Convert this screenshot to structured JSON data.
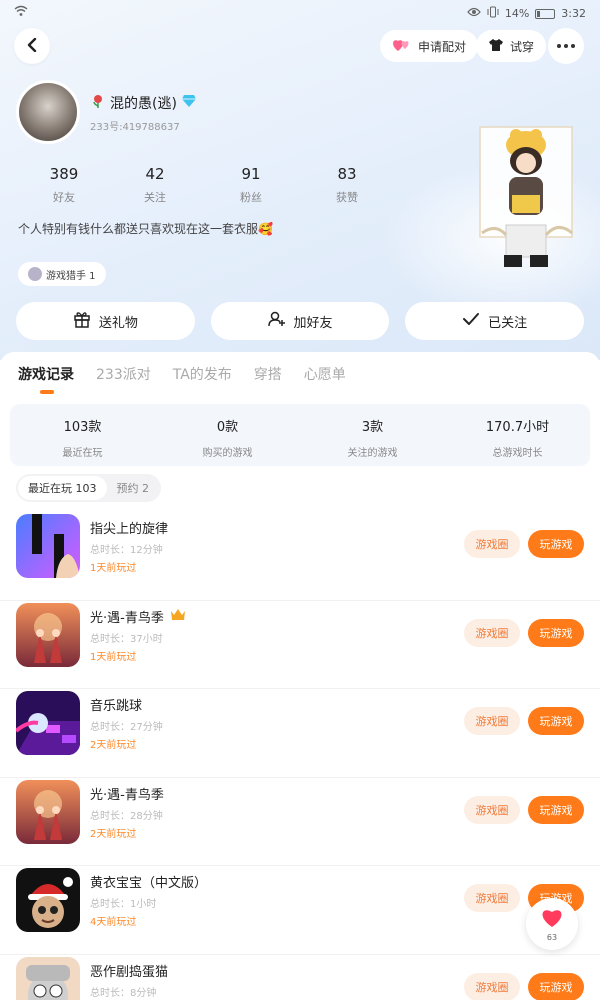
{
  "status_bar": {
    "battery": "14%",
    "time": "3:32"
  },
  "top_bar": {
    "apply_match": "申请配对",
    "try_on": "试穿"
  },
  "profile": {
    "nickname": "混的愚(逃)",
    "uid": "233号:419788637",
    "stats": [
      {
        "value": "389",
        "label": "好友"
      },
      {
        "value": "42",
        "label": "关注"
      },
      {
        "value": "91",
        "label": "粉丝"
      },
      {
        "value": "83",
        "label": "获赞"
      }
    ],
    "bio": "个人特别有钱什么都送只喜欢现在这一套衣服🥰",
    "tag": "游戏猎手 1"
  },
  "actions": {
    "gift": "送礼物",
    "add_friend": "加好友",
    "followed": "已关注"
  },
  "tabs": [
    "游戏记录",
    "233派对",
    "TA的发布",
    "穿搭",
    "心愿单"
  ],
  "summary": [
    {
      "value": "103款",
      "label": "最近在玩"
    },
    {
      "value": "0款",
      "label": "购买的游戏"
    },
    {
      "value": "3款",
      "label": "关注的游戏"
    },
    {
      "value": "170.7小时",
      "label": "总游戏时长"
    }
  ],
  "subtabs": [
    "最近在玩 103",
    "预约 2"
  ],
  "games": [
    {
      "name": "指尖上的旋律",
      "time": "总时长：12分钟",
      "last": "1天前玩过"
    },
    {
      "name": "光·遇-青鸟季",
      "time": "总时长：37小时",
      "last": "1天前玩过"
    },
    {
      "name": "音乐跳球",
      "time": "总时长：27分钟",
      "last": "2天前玩过"
    },
    {
      "name": "光·遇-青鸟季",
      "time": "总时长：28分钟",
      "last": "2天前玩过"
    },
    {
      "name": "黄衣宝宝（中文版）",
      "time": "总时长：1小时",
      "last": "4天前玩过"
    },
    {
      "name": "恶作剧捣蛋猫",
      "time": "总时长：8分钟",
      "last": ""
    }
  ],
  "game_buttons": {
    "circle": "游戏圈",
    "play": "玩游戏"
  },
  "float_like": {
    "count": "63"
  }
}
